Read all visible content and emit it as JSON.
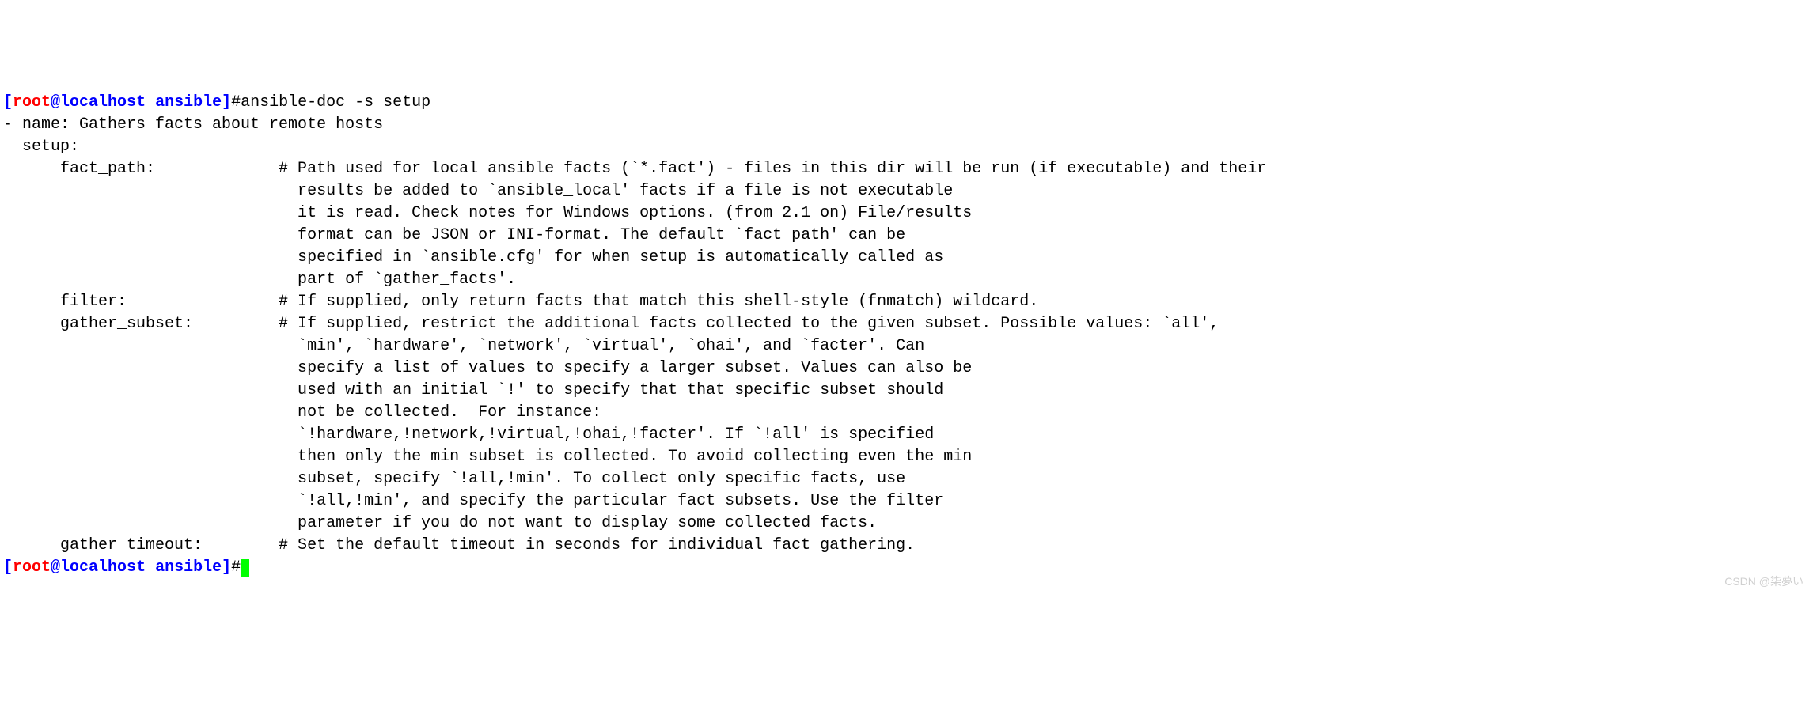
{
  "prompt1": {
    "bracket_open": "[",
    "user": "root",
    "at": "@",
    "host": "localhost",
    "space": " ",
    "path": "ansible",
    "bracket_close": "]",
    "hash": "#"
  },
  "command1": "ansible-doc -s setup",
  "output": {
    "line1": "- name: Gathers facts about remote hosts",
    "line2": "  setup:",
    "line3": "      fact_path:             # Path used for local ansible facts (`*.fact') - files in this dir will be run (if executable) and their",
    "line4": "                               results be added to `ansible_local' facts if a file is not executable",
    "line5": "                               it is read. Check notes for Windows options. (from 2.1 on) File/results",
    "line6": "                               format can be JSON or INI-format. The default `fact_path' can be",
    "line7": "                               specified in `ansible.cfg' for when setup is automatically called as",
    "line8": "                               part of `gather_facts'.",
    "line9": "      filter:                # If supplied, only return facts that match this shell-style (fnmatch) wildcard.",
    "line10": "      gather_subset:         # If supplied, restrict the additional facts collected to the given subset. Possible values: `all',",
    "line11": "                               `min', `hardware', `network', `virtual', `ohai', and `facter'. Can",
    "line12": "                               specify a list of values to specify a larger subset. Values can also be",
    "line13": "                               used with an initial `!' to specify that that specific subset should",
    "line14": "                               not be collected.  For instance:",
    "line15": "                               `!hardware,!network,!virtual,!ohai,!facter'. If `!all' is specified",
    "line16": "                               then only the min subset is collected. To avoid collecting even the min",
    "line17": "                               subset, specify `!all,!min'. To collect only specific facts, use",
    "line18": "                               `!all,!min', and specify the particular fact subsets. Use the filter",
    "line19": "                               parameter if you do not want to display some collected facts.",
    "line20": "      gather_timeout:        # Set the default timeout in seconds for individual fact gathering."
  },
  "prompt2": {
    "bracket_open": "[",
    "user": "root",
    "at": "@",
    "host": "localhost",
    "space": " ",
    "path": "ansible",
    "bracket_close": "]",
    "hash": "#"
  },
  "watermark": "CSDN @柒夢い"
}
